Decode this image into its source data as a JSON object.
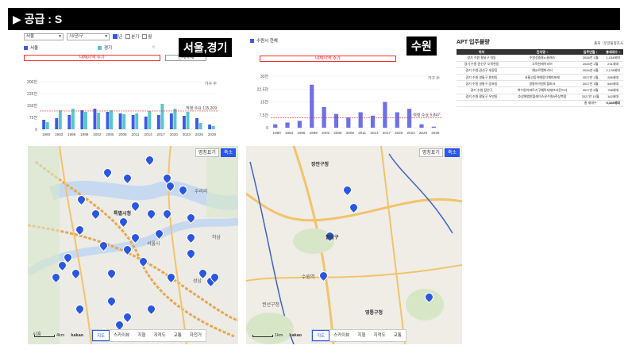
{
  "header": {
    "title": "▶ 공급 : S"
  },
  "seoul": {
    "region_select": "서울",
    "district_select": "시/군/구",
    "checks": [
      "년",
      "분기",
      "월"
    ],
    "region_label": "서울,경기",
    "legend_seoul": "서울",
    "legend_gyeonggi": "경기",
    "add_button": "대체지역 추가",
    "clear_button": "전체삭제",
    "unit": "가구 수",
    "avg_label": "적정 수요",
    "avg_value": "115,209",
    "colors": {
      "seoul": "#3d5be8",
      "gyeonggi": "#5ac6c8"
    }
  },
  "suwon": {
    "series_name": "수원시 전체",
    "region_label": "수원",
    "add_button": "대체지역 추가",
    "unit": "가구 수",
    "avg_label": "적정 수요",
    "avg_value": "5,847",
    "color": "#6f6fe6"
  },
  "table": {
    "title": "APT 입주물량",
    "source": "출처 : 분양물량조사",
    "headers": [
      "위치",
      "단지명 ↕",
      "입주년월 ↕",
      "총세대수 ↕"
    ],
    "rows": [
      [
        "경기 수원 팔달구 지동",
        "수원성중흥s-클래스",
        "2026년 1월",
        "1,154세대"
      ],
      [
        "경기 수원 권선구 오목천동",
        "오목천제이리브",
        "2026년 2월",
        "231세대"
      ],
      [
        "경기 수원 권선구 세류동",
        "해교르엘마스터",
        "2026년 6월",
        "2,178세대"
      ],
      [
        "경기 수원 영통구 원천동",
        "서울고등이매망다해피포레",
        "2027년 2월",
        "285세대"
      ],
      [
        "경기 수원 영통구 망포동",
        "영통아이센트힐파크",
        "2027년 3월",
        "580세대"
      ],
      [
        "경기 수원 장안구",
        "북수원아파트기구예탁지에브라운드타",
        "2027년 6월",
        "768세대"
      ],
      [
        "경기 수원 팔달구 우만동",
        "호성해법한플레이스유수원5주상복합",
        "2027년 10월",
        "162세대"
      ]
    ],
    "total_label": "총 세대수",
    "total_value": "5,328세대"
  },
  "map1": {
    "btn_label": "명칭표기",
    "btn_shrink": "축소",
    "tabs": [
      "지도",
      "스카이뷰",
      "지형",
      "지적도",
      "교통",
      "자전거"
    ],
    "active_tab": "지도",
    "scale_label": "4km",
    "kakao": "kakao",
    "labels": [
      "특별시청",
      "수리리",
      "서울시",
      "시흥",
      "성남",
      "하남"
    ]
  },
  "map2": {
    "btn_label": "명칭표기",
    "btn_shrink": "축소",
    "tabs": [
      "지도",
      "스카이뷰",
      "지형",
      "지적도",
      "교통"
    ],
    "active_tab": "지도",
    "scale_label": "1km",
    "kakao": "kakao",
    "labels": [
      "장안구청",
      "팔달구",
      "수원역",
      "영통구청",
      "권선구청"
    ]
  },
  "chart_data": [
    {
      "type": "bar",
      "title": "",
      "ylabel": "가구 수",
      "ylim": [
        0,
        300000
      ],
      "y_ticks": [
        "0",
        "75천",
        "150천",
        "225천",
        "300천"
      ],
      "categories": [
        "1990",
        "1993",
        "1996",
        "1999",
        "2002",
        "2005",
        "2008",
        "2011",
        "2014",
        "2017",
        "2020",
        "2023",
        "2026",
        "2029"
      ],
      "series": [
        {
          "name": "서울",
          "values": [
            60000,
            70000,
            90000,
            120000,
            130000,
            110000,
            100000,
            90000,
            80000,
            90000,
            100000,
            85000,
            70000,
            30000
          ]
        },
        {
          "name": "경기",
          "values": [
            45000,
            120000,
            130000,
            110000,
            105000,
            120000,
            95000,
            100000,
            115000,
            160000,
            130000,
            110000,
            40000,
            20000
          ]
        }
      ],
      "average": 115209
    },
    {
      "type": "bar",
      "title": "",
      "ylabel": "가구 수",
      "ylim": [
        0,
        30000
      ],
      "y_ticks": [
        "0",
        "7.5천",
        "15천",
        "22.5천",
        "30천"
      ],
      "categories": [
        "1990",
        "1993",
        "1996",
        "1999",
        "2002",
        "2005",
        "2008",
        "2011",
        "2014",
        "2017",
        "2020",
        "2023",
        "2026",
        "2029"
      ],
      "series": [
        {
          "name": "수원시 전체",
          "values": [
            2000,
            3000,
            4000,
            25000,
            12000,
            8000,
            6000,
            9000,
            7000,
            15000,
            9000,
            11000,
            2000,
            600
          ]
        }
      ],
      "average": 5847
    }
  ]
}
